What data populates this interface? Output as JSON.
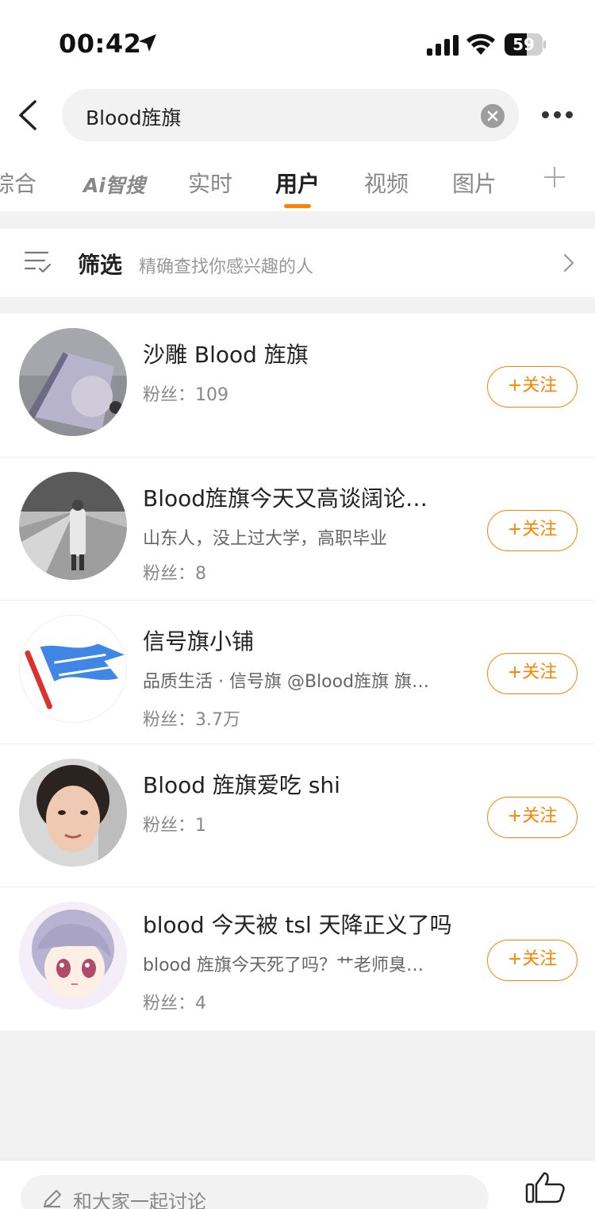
{
  "status_bar": {
    "time": "00:42",
    "battery": "59",
    "battery_level": 0.59
  },
  "search": {
    "query": "Blood旌旗"
  },
  "tabs": [
    {
      "label": "综合"
    },
    {
      "label": "Ai智搜"
    },
    {
      "label": "实时"
    },
    {
      "label": "用户"
    },
    {
      "label": "视频"
    },
    {
      "label": "图片"
    }
  ],
  "active_tab": "用户",
  "filter": {
    "label": "筛选",
    "description": "精确查找你感兴趣的人"
  },
  "users": [
    {
      "name": "沙雕 Blood 旌旗",
      "description": "",
      "fans": "粉丝：109",
      "follow_label": "+关注"
    },
    {
      "name": "Blood旌旗今天又高谈阔论…",
      "description": "山东人，没上过大学，高职毕业",
      "fans": "粉丝：8",
      "follow_label": "+关注"
    },
    {
      "name": "信号旗小铺",
      "description": "品质生活 · 信号旗 @Blood旌旗 旗…",
      "fans": "粉丝：3.7万",
      "follow_label": "+关注"
    },
    {
      "name": "Blood 旌旗爱吃 shi",
      "description": "",
      "fans": "粉丝：1",
      "follow_label": "+关注"
    },
    {
      "name": "blood 今天被 tsl 天降正义了吗",
      "description": "blood 旌旗今天死了吗？艹老师臭…",
      "fans": "粉丝：4",
      "follow_label": "+关注"
    }
  ],
  "comment": {
    "placeholder": "和大家一起讨论"
  },
  "colors": {
    "accent": "#ff8200",
    "flag_blue": "#3f86e6",
    "flag_red": "#d9342c"
  }
}
